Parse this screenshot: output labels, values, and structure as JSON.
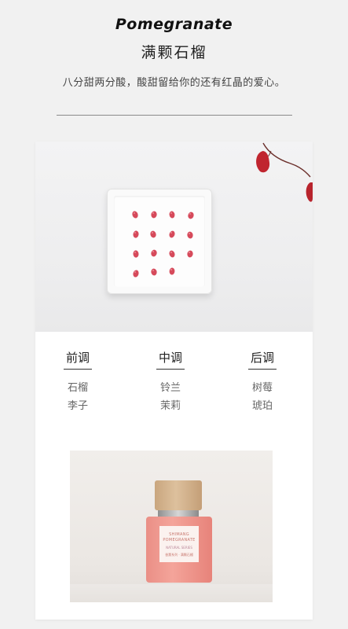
{
  "header": {
    "title_en": "Pomegranate",
    "title_cn": "满颗石榴",
    "tagline": "八分甜两分酸，酸甜留给你的还有红晶的爱心。"
  },
  "notes": {
    "top": {
      "heading": "前调",
      "items": [
        "石榴",
        "李子"
      ]
    },
    "middle": {
      "heading": "中调",
      "items": [
        "铃兰",
        "茉莉"
      ]
    },
    "base": {
      "heading": "后调",
      "items": [
        "树莓",
        "琥珀"
      ]
    }
  },
  "product_label": {
    "line1": "SHIMANG",
    "line2": "POMEGRANATE",
    "line3": "NATURAL SERIES",
    "line4": "香薰系列 · 满颗石榴"
  },
  "colors": {
    "page_bg": "#f1f1f1",
    "seed_red": "#d64a5b",
    "leaf_red": "#c0252f",
    "bottle_pink": "#ef958c"
  },
  "icons": [
    "pomegranate-seed-icon",
    "red-leaf-icon"
  ]
}
